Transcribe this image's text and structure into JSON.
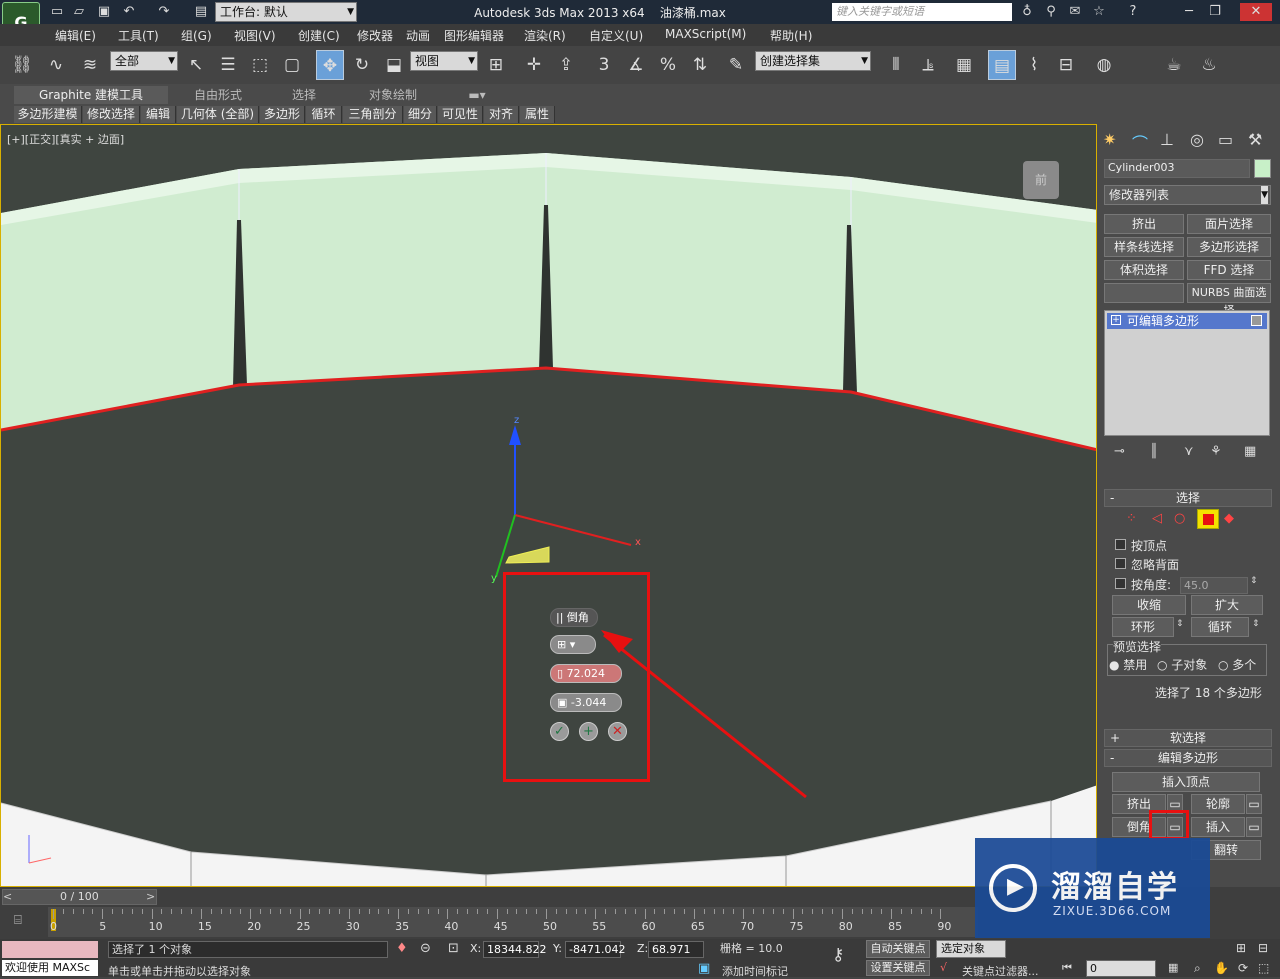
{
  "title": {
    "app": "Autodesk 3ds Max  2013 x64",
    "file": "油漆桶.max",
    "workspace": "工作台: 默认",
    "search_placeholder": "键入关键字或短语"
  },
  "menu": [
    "编辑(E)",
    "工具(T)",
    "组(G)",
    "视图(V)",
    "创建(C)",
    "修改器",
    "动画",
    "图形编辑器",
    "渲染(R)",
    "自定义(U)",
    "MAXScript(M)",
    "帮助(H)"
  ],
  "toolbar": {
    "filter": "全部",
    "refcoord": "视图",
    "named_sel": "创建选择集",
    "snap3": "3",
    "snap_pct": "%"
  },
  "ribbon": {
    "tabs": [
      "Graphite 建模工具",
      "自由形式",
      "选择",
      "对象绘制"
    ],
    "items": [
      "多边形建模",
      "修改选择",
      "编辑",
      "几何体 (全部)",
      "多边形",
      "循环",
      "三角剖分",
      "细分",
      "可见性",
      "对齐",
      "属性"
    ]
  },
  "viewport": {
    "label": "[+][正交][真实 + 边面]",
    "viewcube": "前",
    "caddy": {
      "title": "倒角",
      "height": "72.024",
      "outline": "-3.044"
    },
    "axis_z": "z",
    "axis_x": "x",
    "axis_y": "y"
  },
  "panel": {
    "object_name": "Cylinder003",
    "modlist": "修改器列表",
    "mod_buttons": [
      "挤出",
      "面片选择",
      "样条线选择",
      "多边形选择",
      "体积选择",
      "FFD 选择",
      "",
      "NURBS 曲面选择"
    ],
    "stack_item": "可编辑多边形",
    "select": {
      "header": "选择",
      "by_vertex": "按顶点",
      "ignore_back": "忽略背面",
      "by_angle": "按角度:",
      "angle_val": "45.0",
      "shrink": "收缩",
      "grow": "扩大",
      "ring": "环形",
      "loop": "循环",
      "preview": "预览选择",
      "disable": "禁用",
      "subobj": "子对象",
      "multi": "多个",
      "status": "选择了 18 个多边形"
    },
    "soft": "软选择",
    "editpoly": "编辑多边形",
    "insert_vertex": "插入顶点",
    "extrude": "挤出",
    "outline": "轮廓",
    "bevel": "倒角",
    "inset": "插入",
    "flip": "翻转"
  },
  "timeline": {
    "frame": "0 / 100",
    "ticks": [
      "0",
      "5",
      "10",
      "15",
      "20",
      "25",
      "30",
      "35",
      "40",
      "45",
      "50",
      "55",
      "60",
      "65",
      "70",
      "75",
      "80",
      "85",
      "90"
    ]
  },
  "status": {
    "welcome": "欢迎使用 MAXSc",
    "selected": "选择了 1 个对象",
    "prompt": "单击或单击并拖动以选择对象",
    "x_label": "X:",
    "x": "18344.822",
    "y_label": "Y:",
    "y": "-8471.042",
    "z_label": "Z:",
    "z": "68.971",
    "grid": "栅格 = 10.0",
    "autokey": "自动关键点",
    "setkey": "设置关键点",
    "sel_set": "选定对象",
    "add_tag": "添加时间标记",
    "key_filter": "关键点过滤器...",
    "frame_field": "0"
  },
  "watermark": {
    "brand": "溜溜自学",
    "url": "ZIXUE.3D66.COM"
  },
  "colors": {
    "accent_red": "#e81010",
    "highlight_blue": "#6aa0d8"
  }
}
